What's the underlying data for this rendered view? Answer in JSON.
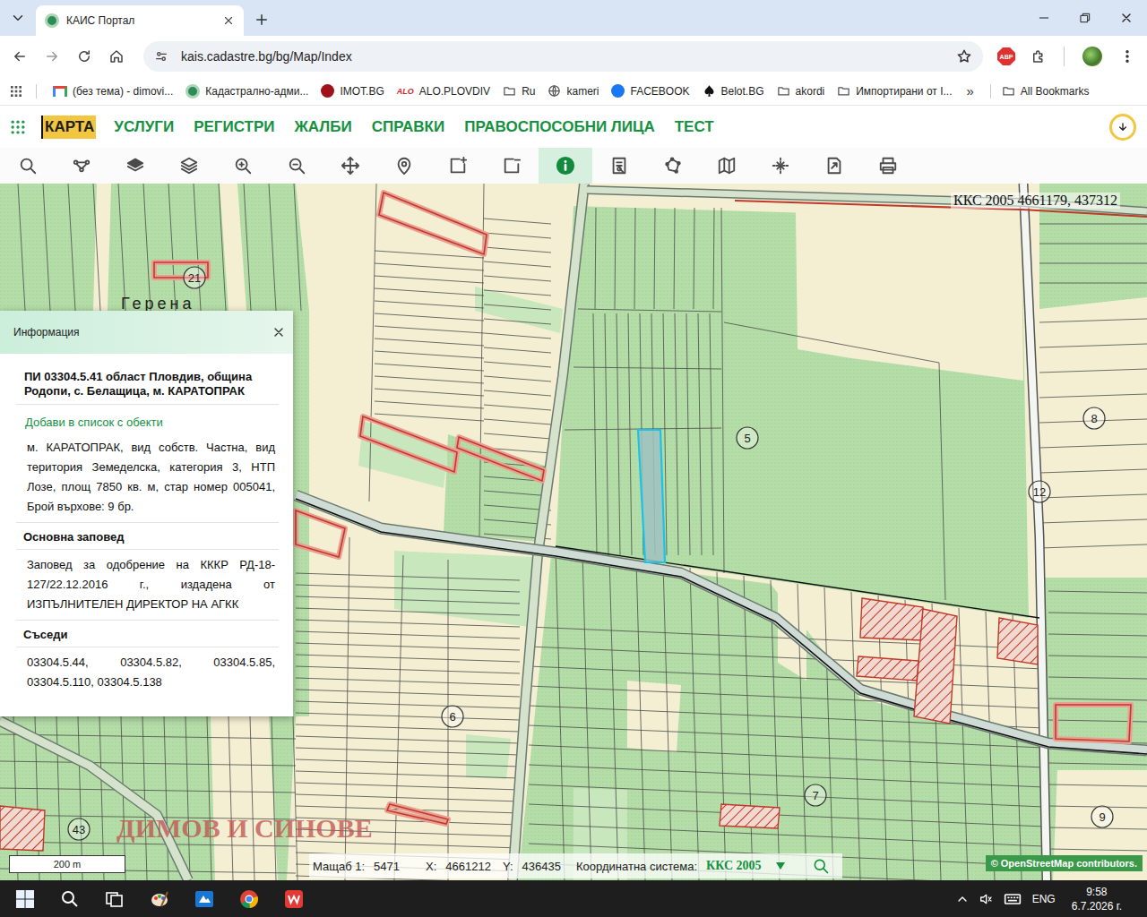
{
  "browser": {
    "tabs": [
      {
        "label": "КАИС Портал",
        "selected": true
      }
    ],
    "url": "kais.cadastre.bg/bg/Map/Index",
    "extension_badge": "ABP",
    "bookmarks": [
      {
        "label": "(без тема) - dimovi...",
        "kind": "gmail"
      },
      {
        "label": "Кадастрално-адми...",
        "kind": "cadastre"
      },
      {
        "label": "IMOT.BG",
        "kind": "imot"
      },
      {
        "label": "ALO.PLOVDIV",
        "kind": "alo",
        "badge": "ALO"
      },
      {
        "label": "Ru",
        "kind": "folder"
      },
      {
        "label": "kameri",
        "kind": "globe"
      },
      {
        "label": "FACEBOOK",
        "kind": "facebook"
      },
      {
        "label": "Belot.BG",
        "kind": "spade"
      },
      {
        "label": "akordi",
        "kind": "folder"
      },
      {
        "label": "Импортирани от I...",
        "kind": "folder"
      }
    ],
    "bookmarks_overflow": "»",
    "all_bookmarks": "All Bookmarks"
  },
  "app_nav": {
    "items": [
      {
        "label": "КАРТА",
        "selected": true
      },
      {
        "label": "УСЛУГИ",
        "selected": false
      },
      {
        "label": "РЕГИСТРИ",
        "selected": false
      },
      {
        "label": "ЖАЛБИ",
        "selected": false
      },
      {
        "label": "СПРАВКИ",
        "selected": false
      },
      {
        "label": "ПРАВОСПОСОБНИ ЛИЦА",
        "selected": false
      },
      {
        "label": "ТЕСТ",
        "selected": false
      }
    ]
  },
  "toolbar": {
    "tools": [
      {
        "kind": "search",
        "selected": false
      },
      {
        "kind": "route",
        "selected": false
      },
      {
        "kind": "layers",
        "selected": false
      },
      {
        "kind": "layers-outline",
        "selected": false
      },
      {
        "kind": "zoom-in",
        "selected": false
      },
      {
        "kind": "zoom-out",
        "selected": false
      },
      {
        "kind": "pan",
        "selected": false
      },
      {
        "kind": "pin",
        "selected": false
      },
      {
        "kind": "rect-add",
        "selected": false
      },
      {
        "kind": "rect-remove",
        "selected": false
      },
      {
        "kind": "info",
        "selected": true
      },
      {
        "kind": "document",
        "selected": false
      },
      {
        "kind": "polygon",
        "selected": false
      },
      {
        "kind": "map",
        "selected": false
      },
      {
        "kind": "measure",
        "selected": false
      },
      {
        "kind": "export",
        "selected": false
      },
      {
        "kind": "print",
        "selected": false
      }
    ]
  },
  "map": {
    "coords_label": "ККС 2005 4661179, 437312",
    "locality": "Герена",
    "watermark": "ДИМОВ И СИНОВЕ",
    "markers": [
      {
        "label": "21"
      },
      {
        "label": "5"
      },
      {
        "label": "8"
      },
      {
        "label": "12"
      },
      {
        "label": "6"
      },
      {
        "label": "7"
      },
      {
        "label": "43"
      },
      {
        "label": "9"
      }
    ],
    "selected_parcel": {
      "selected": true
    },
    "scale_bar": "200 m",
    "attribution": "© OpenStreetMap contributors."
  },
  "status_bar": {
    "scale_label": "Мащаб 1:",
    "scale": "5471",
    "x_label": "X:",
    "x": "4661212",
    "y_label": "Y:",
    "y": "436435",
    "crs_label": "Координатна система:",
    "crs": "ККС 2005"
  },
  "info_panel": {
    "title": "Информация",
    "heading": "ПИ 03304.5.41 област Пловдив, община Родопи, с. Белащица, м. КАРАТОПРАК",
    "add_link": "Добави в список с обекти",
    "description": "м. КАРАТОПРАК, вид собств. Частна, вид територия Земеделска, категория 3, НТП Лозе, площ 7850 кв. м, стар номер 005041, Брой върхове: 9 бр.",
    "sections": [
      {
        "title": "Основна заповед",
        "text": "Заповед за одобрение на КККР РД-18-127/22.12.2016 г., издадена от ИЗПЪЛНИТЕЛЕН ДИРЕКТОР НА АГКК"
      },
      {
        "title": "Съседи",
        "text": "03304.5.44, 03304.5.82, 03304.5.85, 03304.5.110, 03304.5.138"
      }
    ]
  },
  "taskbar": {
    "apps": [
      {
        "kind": "start"
      },
      {
        "kind": "search"
      },
      {
        "kind": "task-view"
      },
      {
        "kind": "paint"
      },
      {
        "kind": "blue-app"
      },
      {
        "kind": "chrome"
      },
      {
        "kind": "wps"
      }
    ],
    "language": "ENG",
    "time": "9:58",
    "date": "6.7.2026 г."
  }
}
